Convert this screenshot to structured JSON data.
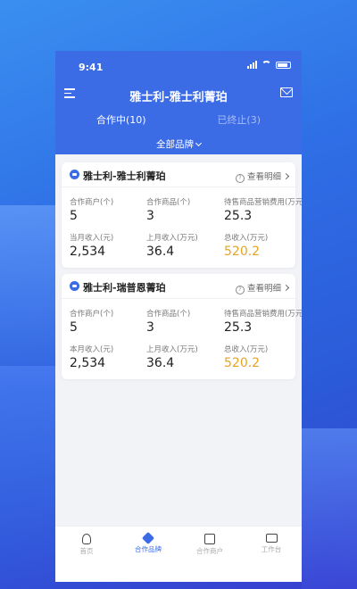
{
  "status_bar": {
    "time": "9:41"
  },
  "header": {
    "title": "雅士利-雅士利菁珀",
    "tabs": [
      {
        "label": "合作中(10)",
        "active": true
      },
      {
        "label": "已终止(3)",
        "active": false
      }
    ],
    "brand_filter": "全部品牌"
  },
  "cards": [
    {
      "name": "雅士利-雅士利菁珀",
      "detail_label": "查看明细",
      "stats": [
        {
          "label": "合作商户(个)",
          "value": "5"
        },
        {
          "label": "合作商品(个)",
          "value": "3"
        },
        {
          "label": "待售商品营销费用(万元)",
          "value": "25.3"
        },
        {
          "label": "当月收入(元)",
          "value": "2,534"
        },
        {
          "label": "上月收入(万元)",
          "value": "36.4"
        },
        {
          "label": "总收入(万元)",
          "value": "520.2"
        }
      ]
    },
    {
      "name": "雅士利-瑞普恩菁珀",
      "detail_label": "查看明细",
      "stats": [
        {
          "label": "合作商户(个)",
          "value": "5"
        },
        {
          "label": "合作商品(个)",
          "value": "3"
        },
        {
          "label": "待售商品营销费用(万元)",
          "value": "25.3"
        },
        {
          "label": "本月收入(元)",
          "value": "2,534"
        },
        {
          "label": "上月收入(万元)",
          "value": "36.4"
        },
        {
          "label": "总收入(万元)",
          "value": "520.2"
        }
      ]
    }
  ],
  "bottom_nav": [
    {
      "label": "首页",
      "icon": "user-icon",
      "active": false
    },
    {
      "label": "合作品牌",
      "icon": "brand-icon",
      "active": true
    },
    {
      "label": "合作商户",
      "icon": "shop-icon",
      "active": false
    },
    {
      "label": "工作台",
      "icon": "desk-icon",
      "active": false
    }
  ],
  "colors": {
    "primary": "#3c6be6",
    "highlight": "#e8a323",
    "background": "#f2f3f7"
  }
}
